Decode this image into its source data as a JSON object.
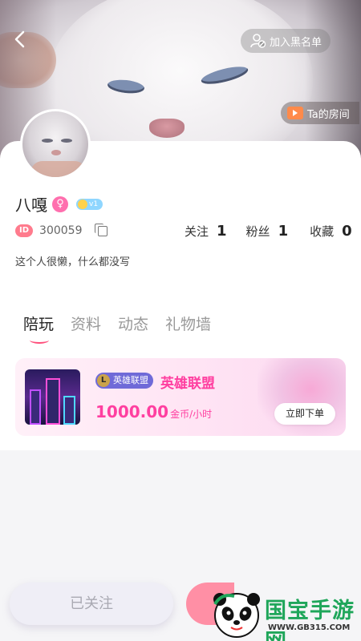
{
  "header": {
    "back_icon": "chevron-left-icon",
    "blacklist_label": "加入黑名单",
    "room_label": "Ta的房间"
  },
  "profile": {
    "name": "八嘎",
    "gender_symbol": "♀",
    "level": "v1",
    "id_tag": "ID",
    "id_value": "300059",
    "bio": "这个人很懒，什么都没写",
    "stats": [
      {
        "label": "关注",
        "value": "1"
      },
      {
        "label": "粉丝",
        "value": "1"
      },
      {
        "label": "收藏",
        "value": "0"
      }
    ]
  },
  "tabs": [
    {
      "label": "陪玩",
      "active": true
    },
    {
      "label": "资料",
      "active": false
    },
    {
      "label": "动态",
      "active": false
    },
    {
      "label": "礼物墙",
      "active": false
    }
  ],
  "game_card": {
    "tag": "英雄联盟",
    "tag_icon_text": "L",
    "title": "英雄联盟",
    "price": "1000.00",
    "price_unit": "金币/小时",
    "order_label": "立即下单"
  },
  "bottom": {
    "follow_label": "已关注"
  },
  "watermark": {
    "title": "国宝手游网",
    "url": "WWW.GB315.COM"
  },
  "colors": {
    "accent_pink": "#ff3fa0",
    "tab_underline": "#ff4d7a",
    "watermark_green": "#1fa65a"
  }
}
